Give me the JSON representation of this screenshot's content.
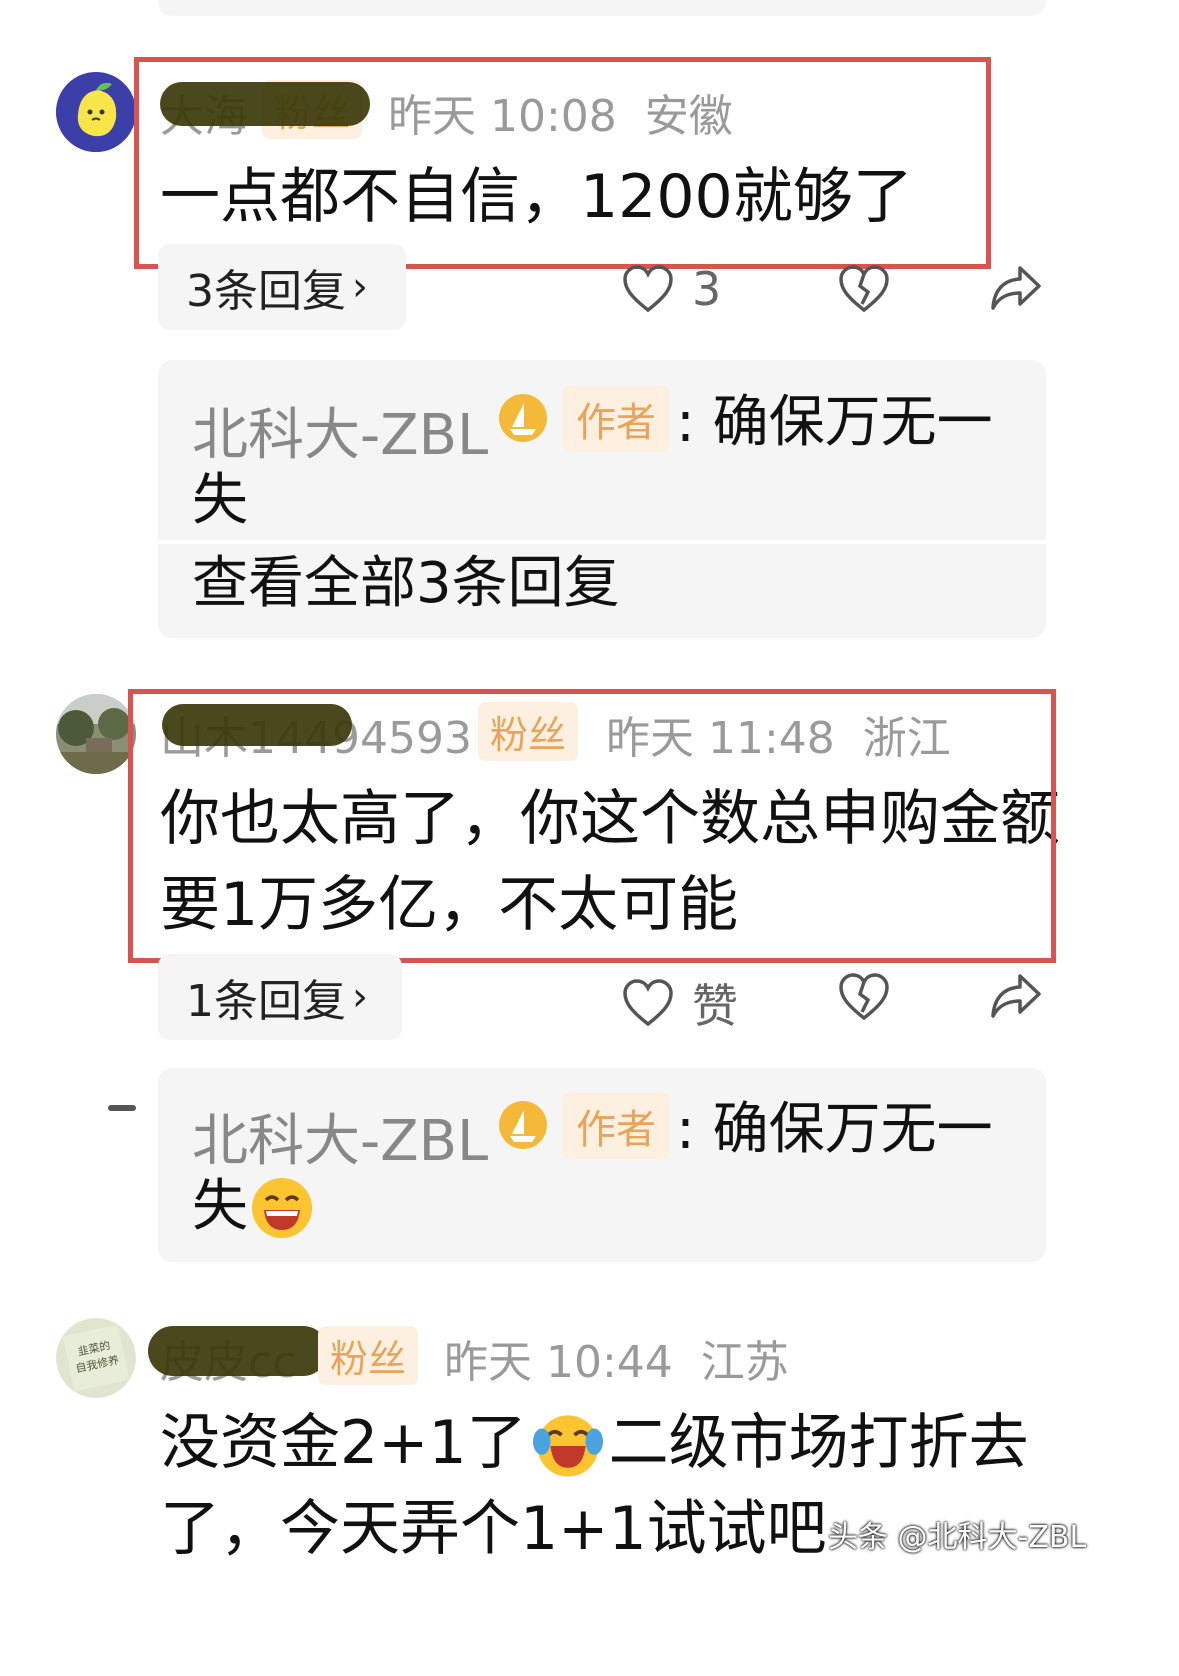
{
  "comments": [
    {
      "name_partial": "大海",
      "fan_badge": "粉丝",
      "time": "昨天 10:08",
      "location": "安徽",
      "text": "一点都不自信，1200就够了",
      "replies_label": "3条回复",
      "like_count": "3",
      "author_reply": {
        "name": "北科大-ZBL",
        "tag": "作者",
        "text_line1": ": 确保万无一",
        "text_line2": "失",
        "view_all": "查看全部3条回复"
      }
    },
    {
      "name_partial": "山木14494593",
      "fan_badge": "粉丝",
      "time": "昨天 11:48",
      "location": "浙江",
      "text_line1": "你也太高了，你这个数总申购金额",
      "text_line2": "要1万多亿，不太可能",
      "replies_label": "1条回复",
      "like_label": "赞",
      "author_reply": {
        "name": "北科大-ZBL",
        "tag": "作者",
        "text_line1": ": 确保万无一",
        "text_line2": "失"
      }
    },
    {
      "name_partial": "皮皮cc",
      "fan_badge": "粉丝",
      "time": "昨天 10:44",
      "location": "江苏",
      "text_line1a": "没资金2+1了",
      "text_line1b": "二级市场打折去",
      "text_line2": "了，今天弄个1+1试试吧",
      "avatar_book_text": "韭菜的自我修养"
    }
  ],
  "watermark": "头条 @北科大-ZBL",
  "icons": [
    "heart-icon",
    "broken-heart-icon",
    "share-icon",
    "chevron-right-icon",
    "crown-icon",
    "laughing-emoji",
    "tears-of-joy-emoji"
  ],
  "colors": {
    "highlight_border": "#d9534f",
    "fan_bg": "#fdf0e0",
    "fan_text": "#e6a55a",
    "reply_bg": "#f5f5f5"
  }
}
